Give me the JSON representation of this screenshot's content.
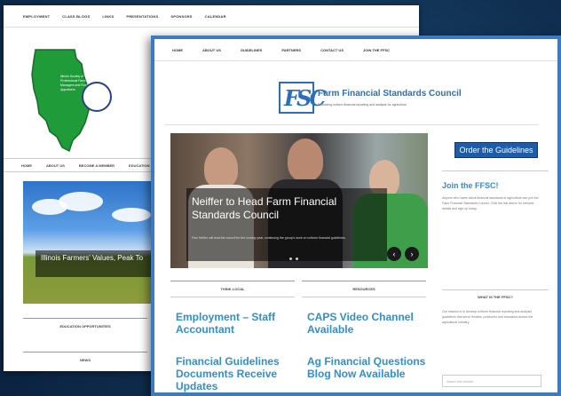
{
  "back_site": {
    "nav": [
      "EMPLOYMENT",
      "CLASS BLOGS",
      "LINKS",
      "PRESENTATIONS",
      "SPONSORS",
      "CALENDAR"
    ],
    "logo_text": "Illinois Society of Professional Farm Managers and Rural Appraisers",
    "nav2": [
      "HOME",
      "ABOUT US",
      "BECOME A MEMBER",
      "EDUCATION"
    ],
    "hero_caption": "Illinois Farmers' Values, Peak To",
    "hero_sub": "",
    "section1": "EDUCATION OPPORTUNITIES",
    "section2": "NEWS"
  },
  "front_site": {
    "nav": [
      "HOME",
      "ABOUT US",
      "GUIDELINES",
      "PARTNERS",
      "CONTACT US",
      "JOIN THE FFSC"
    ],
    "logo_mark": "FSC",
    "org_name": "Farm Financial Standards Council",
    "tagline": "Promoting uniform financial reporting and analysis for agriculture",
    "slide_title": "Neiffer to Head Farm Financial Standards Council",
    "slide_text": "Paul Neiffer will lead the council for the coming year, continuing the group's work on uniform financial guidelines.",
    "prev_arrow": "‹",
    "next_arrow": "›",
    "col1_head": "THINK LOCAL",
    "col2_head": "RESOURCES",
    "col1_links": [
      "Employment – Staff Accountant",
      "Financial Guidelines Documents Receive Updates"
    ],
    "col2_links": [
      "CAPS Video Channel Available",
      "Ag Financial Questions Blog Now Available"
    ],
    "order_button": "Order the Guidelines",
    "join_title": "Join the FFSC!",
    "join_text": "Anyone who cares about financial standards in agriculture can join the Farm Financial Standards Council. Click the link above for member details and sign up today.",
    "what_head": "WHAT IS THE FFSC?",
    "what_text": "Our mission is to develop uniform financial reporting and analysis guidelines that serve lenders, producers and educators across the agricultural industry.",
    "search_placeholder": "Search this website ..."
  },
  "colors": {
    "accent": "#2f8fd0",
    "border": "#3e7ac0",
    "button": "#1e5ba8"
  }
}
